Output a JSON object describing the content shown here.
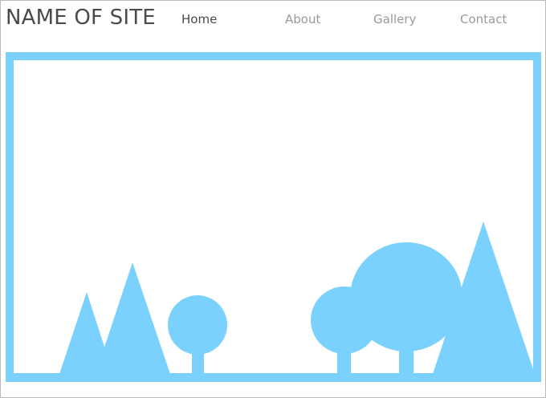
{
  "header": {
    "site_title": "NAME OF SITE"
  },
  "nav": {
    "items": [
      {
        "label": "Home",
        "active": true
      },
      {
        "label": "About",
        "active": false
      },
      {
        "label": "Gallery",
        "active": false
      },
      {
        "label": "Contact",
        "active": false
      }
    ]
  },
  "hero": {
    "accent_color": "#7bd1fd",
    "illustration": "landscape-placeholder-icon"
  },
  "colors": {
    "title_text": "#4a4a4a",
    "nav_active": "#4a4a4a",
    "nav_inactive": "#9a9a9a",
    "accent": "#7bd1fd",
    "page_border": "#b9b9b9"
  }
}
